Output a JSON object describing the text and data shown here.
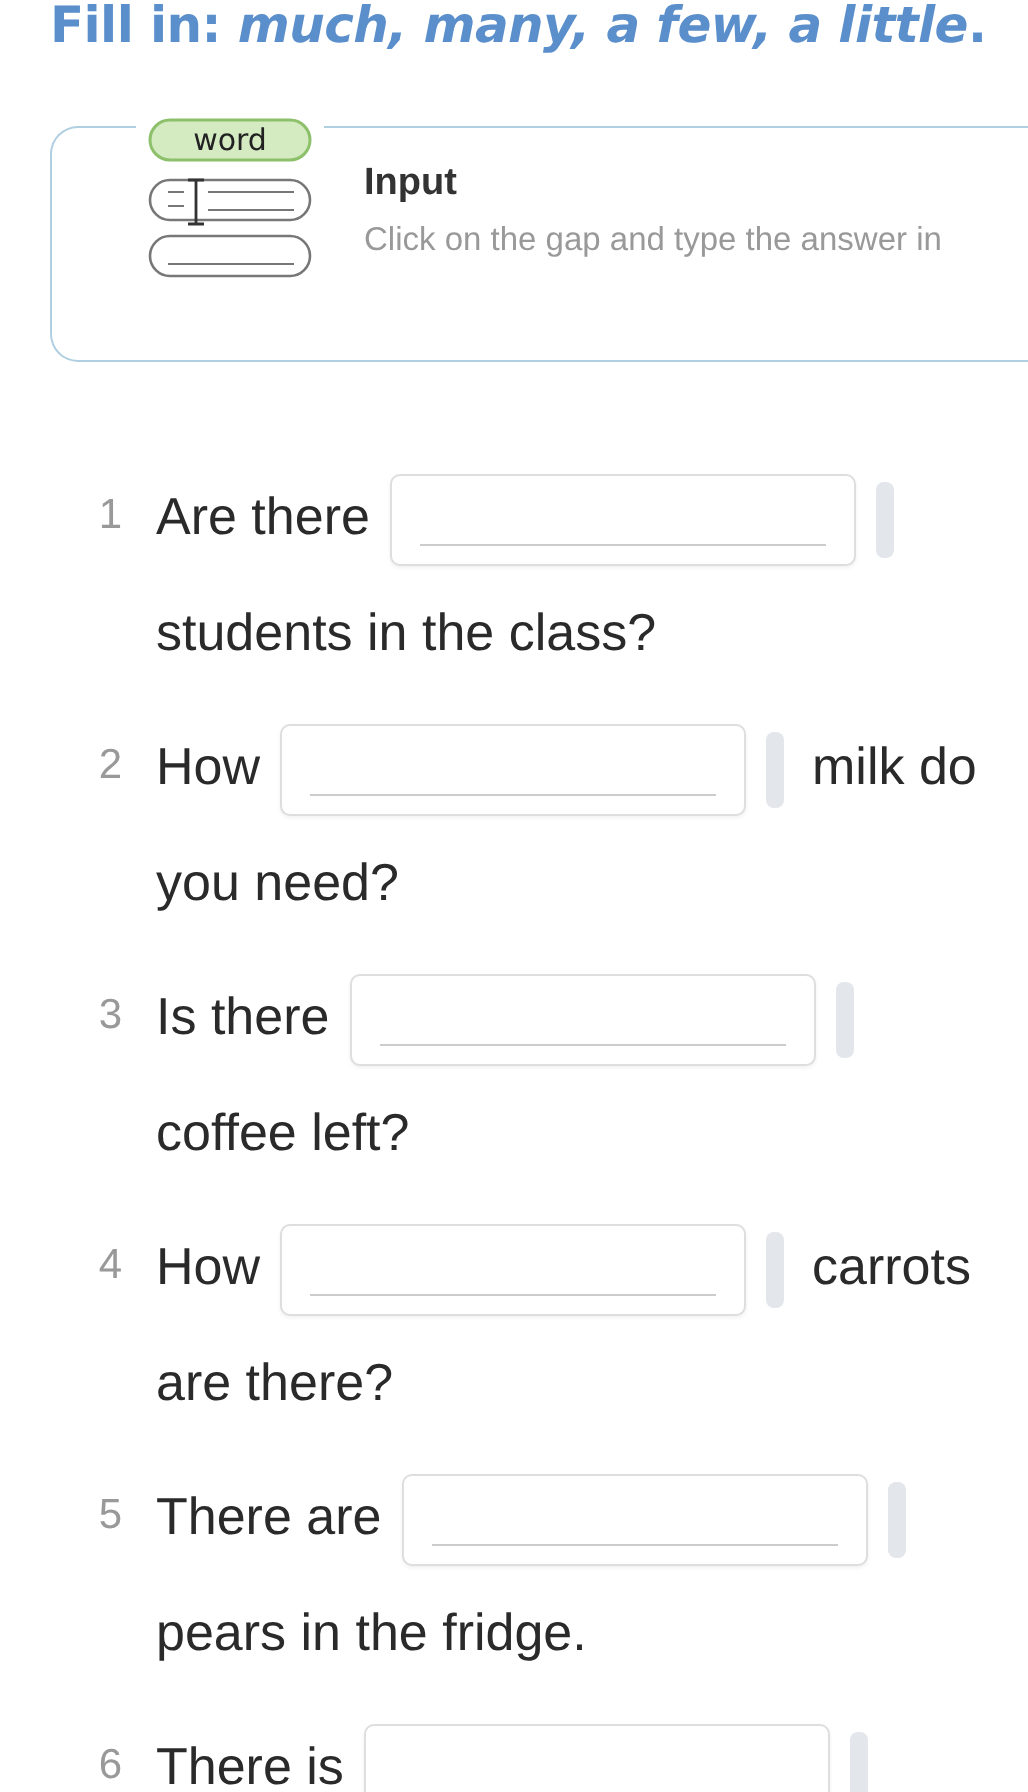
{
  "title": "Fill in: *much, many, a few, a little*.",
  "instruction": {
    "heading": "Input",
    "text": "Click on the gap and type the answer in",
    "icon_label": "word"
  },
  "items": [
    {
      "number": "1",
      "before": "Are there",
      "after": "students in the class?"
    },
    {
      "number": "2",
      "before": "How",
      "after": "milk do you need?"
    },
    {
      "number": "3",
      "before": "Is there",
      "after": "coffee left?"
    },
    {
      "number": "4",
      "before": "How",
      "after": "carrots are there?"
    },
    {
      "number": "5",
      "before": "There are",
      "after": "pears in the fridge."
    },
    {
      "number": "6",
      "before": "There is"
    }
  ]
}
